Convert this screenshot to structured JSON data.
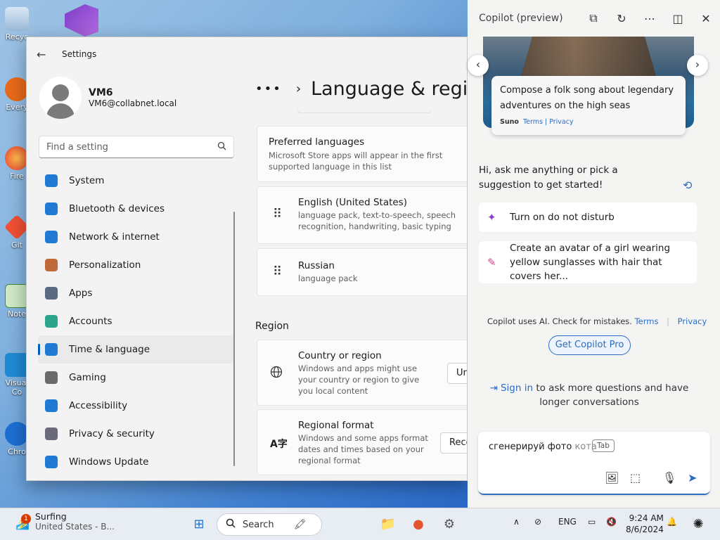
{
  "desktop": {
    "icons": [
      {
        "name": "recycle-bin-icon",
        "label": "Recyc"
      },
      {
        "name": "everything-icon",
        "label": "Every"
      },
      {
        "name": "firefox-desktop-icon",
        "label": "Fire"
      },
      {
        "name": "git-icon",
        "label": "Git"
      },
      {
        "name": "notepad-icon",
        "label": "Note"
      },
      {
        "name": "vscode-icon",
        "label": "Visual Co"
      },
      {
        "name": "chrome-icon",
        "label": "Chro"
      }
    ]
  },
  "settings": {
    "title": "Settings",
    "user": {
      "name": "VM6",
      "email": "VM6@collabnet.local"
    },
    "search_placeholder": "Find a setting",
    "nav": [
      {
        "label": "System",
        "color": "#1f7ad4",
        "icon": "system-icon"
      },
      {
        "label": "Bluetooth & devices",
        "color": "#1f7ad4",
        "icon": "bluetooth-icon"
      },
      {
        "label": "Network & internet",
        "color": "#1f7ad4",
        "icon": "network-icon"
      },
      {
        "label": "Personalization",
        "color": "#c06a3a",
        "icon": "personalization-icon"
      },
      {
        "label": "Apps",
        "color": "#5a6a82",
        "icon": "apps-icon"
      },
      {
        "label": "Accounts",
        "color": "#2aa58b",
        "icon": "accounts-icon"
      },
      {
        "label": "Time & language",
        "color": "#1f7ad4",
        "icon": "time-language-icon"
      },
      {
        "label": "Gaming",
        "color": "#6a6a6a",
        "icon": "gaming-icon"
      },
      {
        "label": "Accessibility",
        "color": "#1f7ad4",
        "icon": "accessibility-icon"
      },
      {
        "label": "Privacy & security",
        "color": "#6a6a7a",
        "icon": "shield-icon"
      },
      {
        "label": "Windows Update",
        "color": "#1f7ad4",
        "icon": "windows-update-icon"
      }
    ],
    "active_nav_index": 6,
    "page_title": "Language & region",
    "preferred": {
      "title": "Preferred languages",
      "desc": "Microsoft Store apps will appear in the first supported language in this list"
    },
    "languages": [
      {
        "name": "English (United States)",
        "desc": "language pack, text-to-speech, speech recognition, handwriting, basic typing"
      },
      {
        "name": "Russian",
        "desc": "language pack"
      }
    ],
    "region_header": "Region",
    "country": {
      "title": "Country or region",
      "desc": "Windows and apps might use your country or region to give you local content",
      "value": "Un"
    },
    "format": {
      "title": "Regional format",
      "desc": "Windows and some apps format dates and times based on your regional format",
      "value": "Reco"
    }
  },
  "copilot": {
    "title": "Copilot (preview)",
    "card": {
      "text": "Compose a folk song about legendary adventures on the high seas",
      "source": "Suno",
      "terms": "Terms",
      "sep": "|",
      "privacy": "Privacy"
    },
    "greeting": "Hi, ask me anything or pick a suggestion to get started!",
    "suggestions": [
      "Turn on do not disturb",
      "Create an avatar of a girl wearing yellow sunglasses with hair that covers her..."
    ],
    "disclaimer": "Copilot uses AI. Check for mistakes.",
    "terms": "Terms",
    "privacy": "Privacy",
    "pro_button": "Get Copilot Pro",
    "signin_link": "Sign in",
    "signin_rest": " to ask more questions and have longer conversations",
    "input_text": "сгенерируй фото ",
    "input_ghost": "кота",
    "tab_hint": "Tab"
  },
  "taskbar": {
    "weather_title": "Surfing",
    "weather_sub": "United States - B...",
    "badge": "1",
    "search": "Search",
    "lang": "ENG",
    "time": "9:24 AM",
    "date": "8/6/2024"
  }
}
